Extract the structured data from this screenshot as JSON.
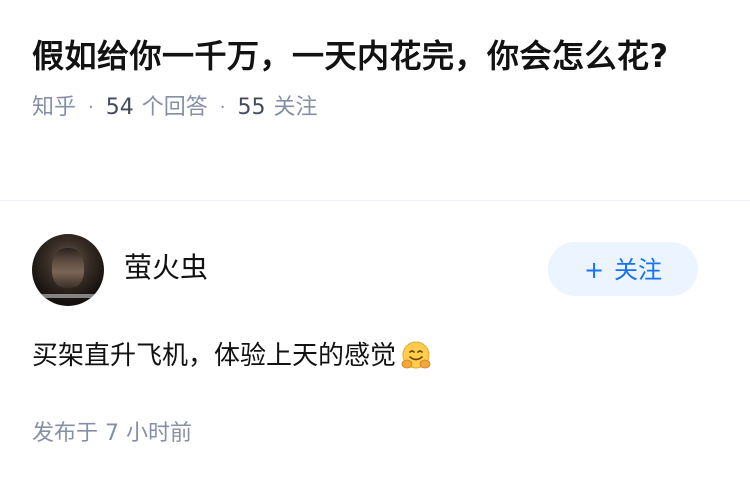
{
  "question": {
    "title": "假如给你一千万，一天内花完，你会怎么花?",
    "source": "知乎",
    "separator": "·",
    "answer_count": "54",
    "answer_count_label": "个回答",
    "follow_count": "55",
    "follow_count_label": "关注"
  },
  "author": {
    "name": "萤火虫",
    "follow_plus": "+",
    "follow_label": "关注"
  },
  "answer": {
    "text": "买架直升飞机，体验上天的感觉",
    "emoji": "hugging-face-icon"
  },
  "publish": {
    "label": "发布于",
    "time": "7 小时前"
  },
  "colors": {
    "accent": "#1772f6",
    "follow_bg": "#ebf4ff",
    "meta": "#8590a6"
  }
}
